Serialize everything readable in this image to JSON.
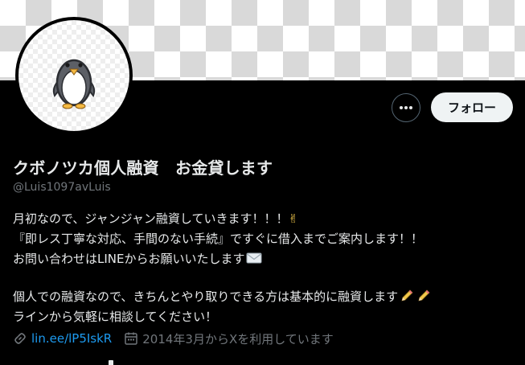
{
  "header": {
    "follow_label": "フォロー",
    "more_icon": "more-horizontal-icon"
  },
  "profile": {
    "display_name": "クボノツカ個人融資　お金貸します",
    "handle": "@Luis1097avLuis",
    "avatar_icon": "penguin-avatar"
  },
  "bio": {
    "lines": [
      {
        "text": "月初なので、ジャンジャン融資していきます！！！",
        "emoji": "victory-hand-emoji"
      },
      {
        "text": "『即レス丁寧な対応、手間のない手続』ですぐに借入までご案内します！！"
      },
      {
        "text": "お問い合わせはLINEからお願いいたします",
        "emoji": "envelope-emoji"
      },
      {
        "text": ""
      },
      {
        "text": "個人での融資なので、きちんとやり取りできる方は基本的に融資します",
        "emoji": "pencil-emoji-x2"
      },
      {
        "text": "ラインから気軽に相談してください！"
      }
    ]
  },
  "meta": {
    "link_text": "lin.ee/lP5IskR",
    "link_icon": "link-icon",
    "joined_text": "2014年3月からXを利用しています",
    "joined_icon": "calendar-icon"
  },
  "colors": {
    "background": "#000000",
    "text": "#e7e9ea",
    "secondary": "#71767b",
    "link": "#1d9bf0",
    "follow_bg": "#eff3f4"
  }
}
